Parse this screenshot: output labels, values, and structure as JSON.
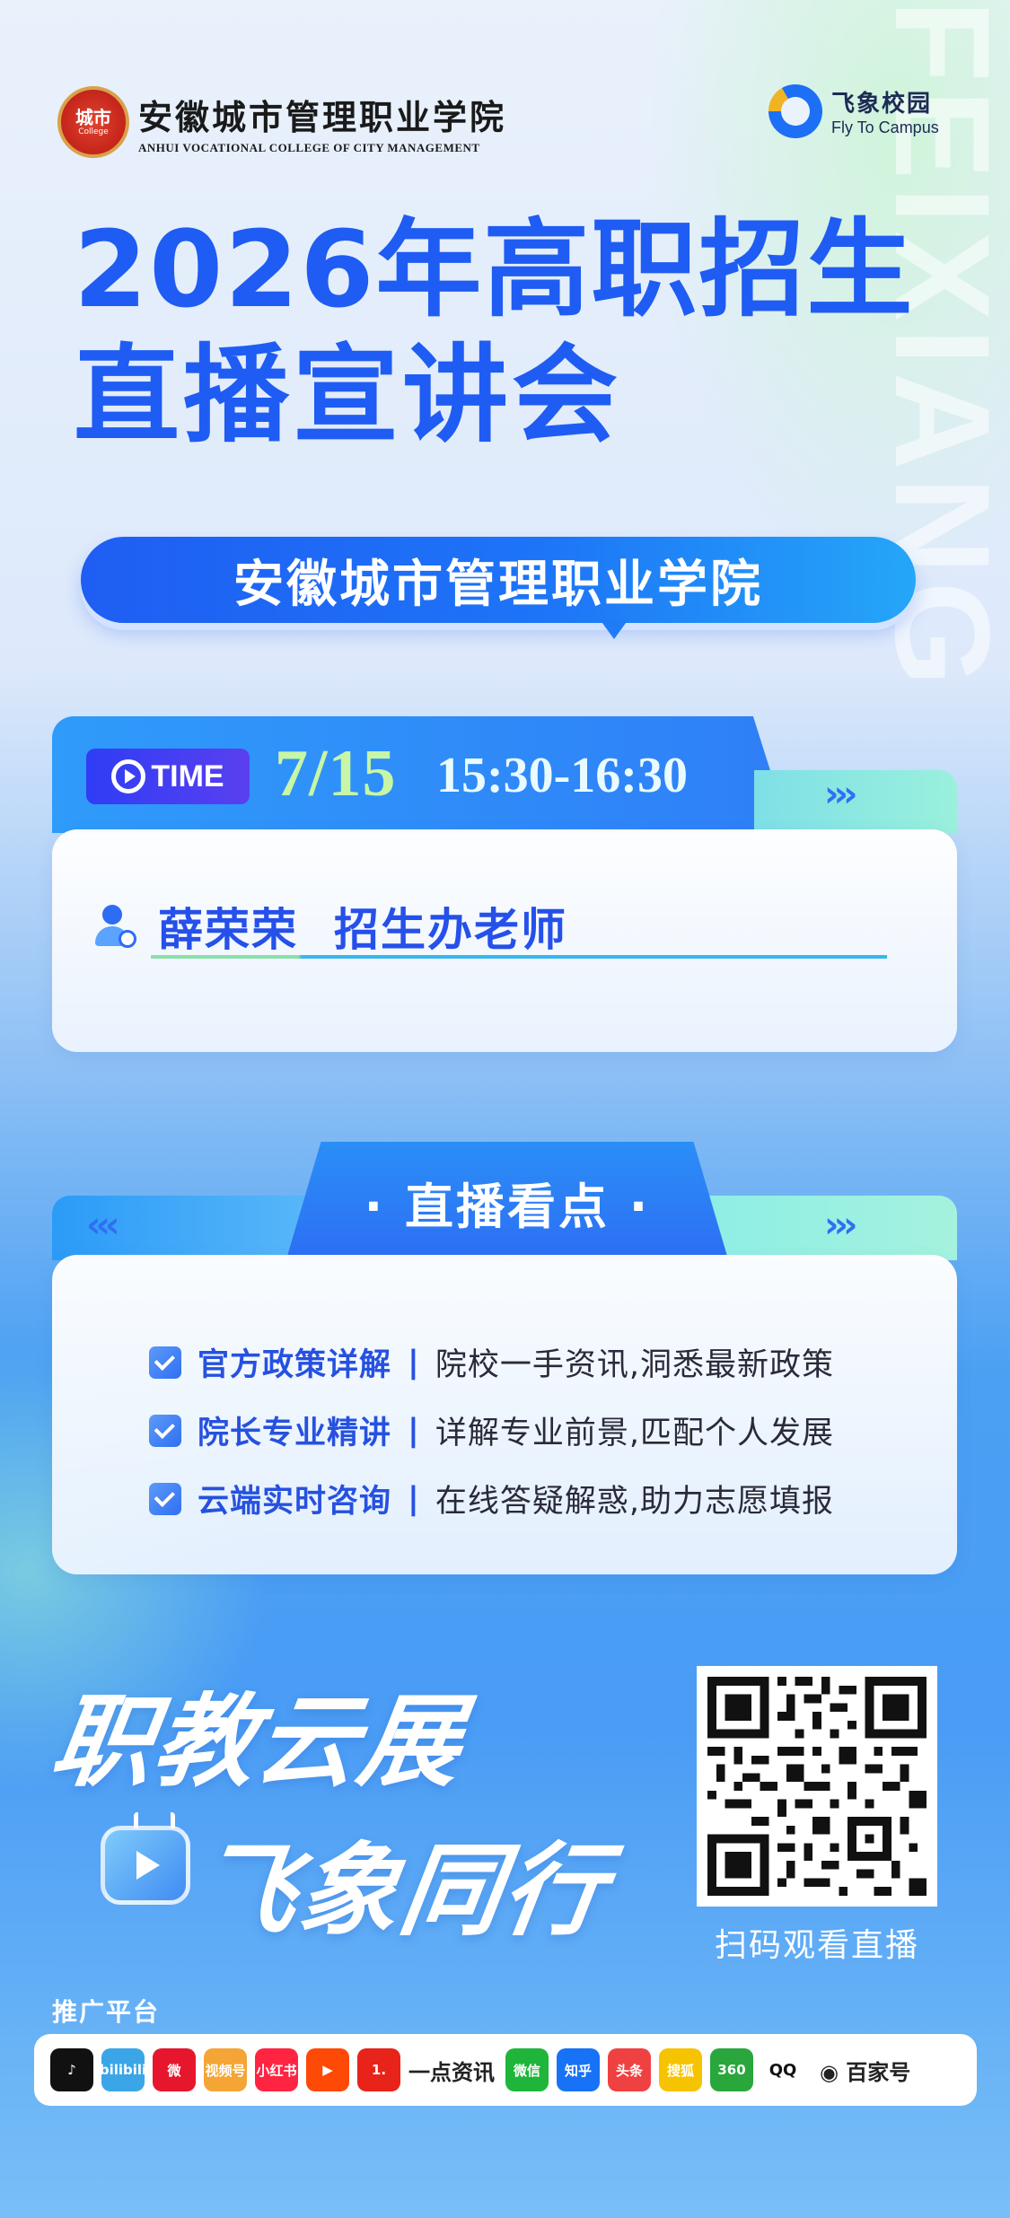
{
  "header": {
    "school_name_cn": "安徽城市管理职业学院",
    "school_name_en": "ANHUI VOCATIONAL COLLEGE OF CITY MANAGEMENT",
    "seal_text_main": "城市",
    "seal_text_sub": "College",
    "brand_name_cn": "飞象校园",
    "brand_name_en": "Fly To Campus",
    "vertical_watermark": "FEIXIANG"
  },
  "title": {
    "line1": "2026年高职招生",
    "line2": "直播宣讲会",
    "school_pill": "安徽城市管理职业学院"
  },
  "time_section": {
    "badge": "TIME",
    "date": "7/15",
    "time_range": "15:30-16:30",
    "arrows": "›››",
    "speaker_name": "薛荣荣",
    "speaker_role": "招生办老师"
  },
  "highlights": {
    "title": "· 直播看点 ·",
    "arrows_left": "‹‹‹",
    "arrows_right": "›››",
    "items": [
      {
        "key": "官方政策详解",
        "sep": "|",
        "desc": "院校一手资讯,洞悉最新政策"
      },
      {
        "key": "院长专业精讲",
        "sep": "|",
        "desc": "详解专业前景,匹配个人发展"
      },
      {
        "key": "云端实时咨询",
        "sep": "|",
        "desc": "在线答疑解惑,助力志愿填报"
      }
    ]
  },
  "slogan": {
    "line1": "职教云展",
    "line2": "飞象同行"
  },
  "qr": {
    "label": "扫码观看直播"
  },
  "platforms": {
    "label": "推广平台",
    "items": [
      {
        "icon": "douyin-icon",
        "text": "♪",
        "color": "#111111"
      },
      {
        "icon": "bilibili-icon",
        "text": "bilibili",
        "color": "#3aa6e8"
      },
      {
        "icon": "weibo-icon",
        "text": "微",
        "color": "#e6162d"
      },
      {
        "icon": "channels-icon",
        "text": "视频号",
        "color": "#f4a535"
      },
      {
        "icon": "xiaohongshu-icon",
        "text": "小红书",
        "color": "#ff2442"
      },
      {
        "icon": "kuaishou-icon",
        "text": "▶",
        "color": "#ff4906"
      },
      {
        "icon": "yidianzixun-icon",
        "text": "1.",
        "color": "#e8231a"
      },
      {
        "icon": "wechat-icon",
        "text": "微信",
        "color": "#1fb53b"
      },
      {
        "icon": "zhihu-icon",
        "text": "知乎",
        "color": "#1772f6"
      },
      {
        "icon": "toutiao-icon",
        "text": "头条",
        "color": "#f04142"
      },
      {
        "icon": "sohu-icon",
        "text": "搜狐",
        "color": "#f6c300"
      },
      {
        "icon": "360-icon",
        "text": "360",
        "color": "#29a73c"
      },
      {
        "icon": "qq-icon",
        "text": "QQ",
        "color": "#222222"
      }
    ],
    "yidian_text": "一点资讯",
    "baijiahao_text": "百家号"
  },
  "colors": {
    "title_blue": "#1f5cf3",
    "accent_green": "#c7f6a6",
    "highlight_key": "#2651e0"
  }
}
